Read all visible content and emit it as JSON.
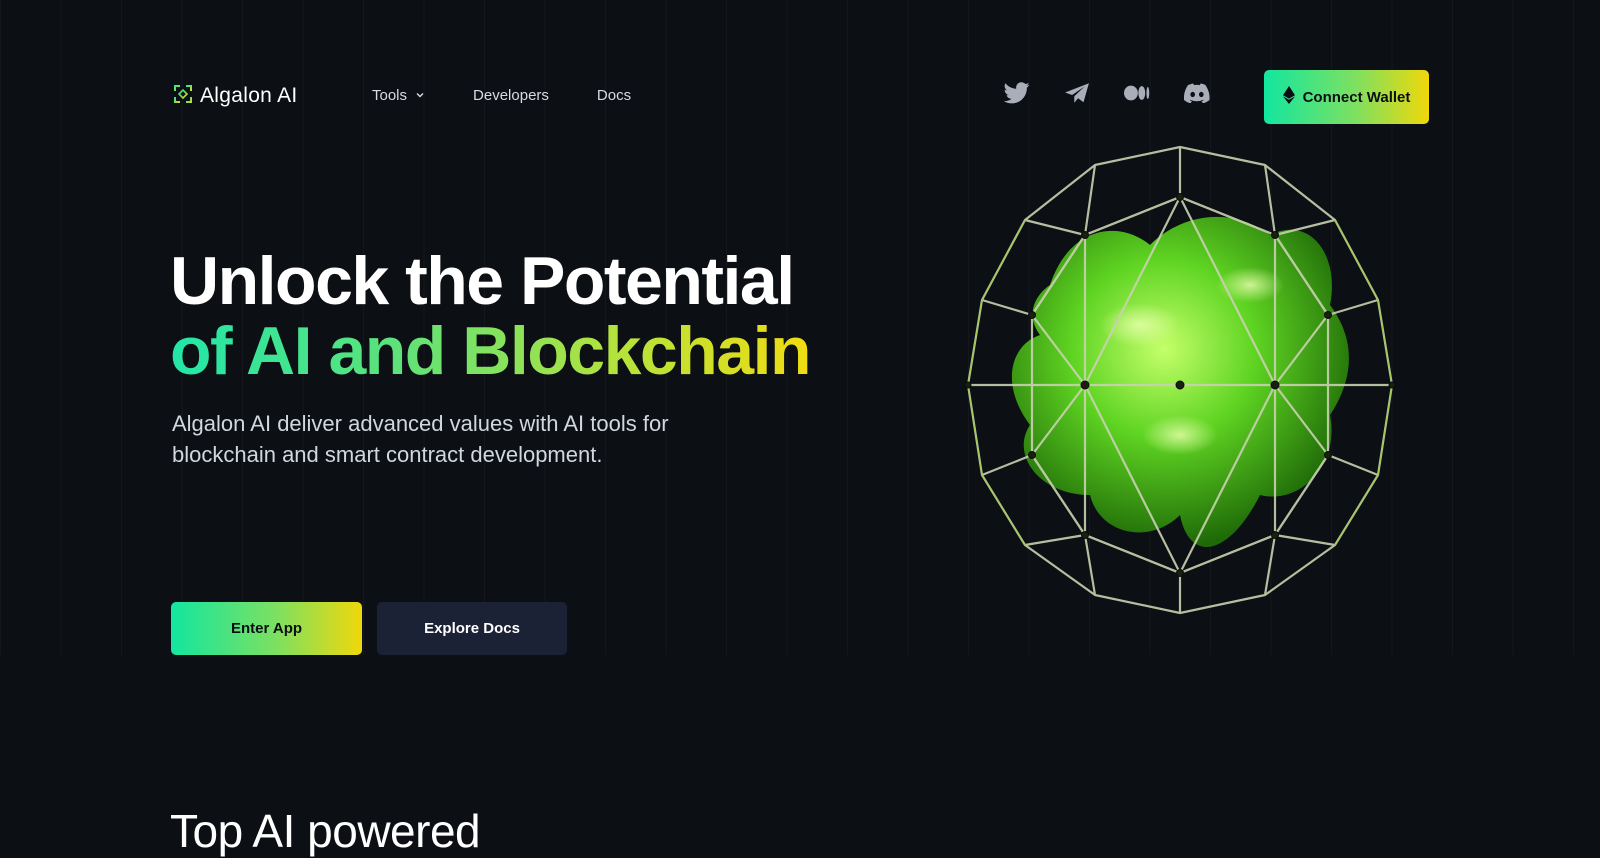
{
  "brand": {
    "name": "Algalon AI",
    "icon": "algalon-logo-icon"
  },
  "nav": {
    "items": [
      {
        "label": "Tools",
        "has_dropdown": true,
        "icon": "chevron-down-icon"
      },
      {
        "label": "Developers"
      },
      {
        "label": "Docs"
      }
    ]
  },
  "socials": [
    {
      "name": "twitter",
      "icon": "twitter-icon"
    },
    {
      "name": "telegram",
      "icon": "telegram-icon"
    },
    {
      "name": "medium",
      "icon": "medium-icon"
    },
    {
      "name": "discord",
      "icon": "discord-icon"
    }
  ],
  "wallet_button": {
    "label": "Connect Wallet",
    "icon": "ethereum-icon"
  },
  "hero": {
    "title_line1": "Unlock the Potential",
    "title_line2": "of AI and Blockchain",
    "subtitle": "Algalon AI deliver advanced values with AI tools for blockchain and smart contract development.",
    "primary_cta": "Enter App",
    "secondary_cta": "Explore Docs",
    "image": "green-blob-wireframe-sphere"
  },
  "next_section": {
    "title": "Top AI powered"
  },
  "colors": {
    "background": "#0c0f14",
    "gradient_start": "#12e6a0",
    "gradient_end": "#f0d80a",
    "secondary_button": "#1c2236"
  }
}
